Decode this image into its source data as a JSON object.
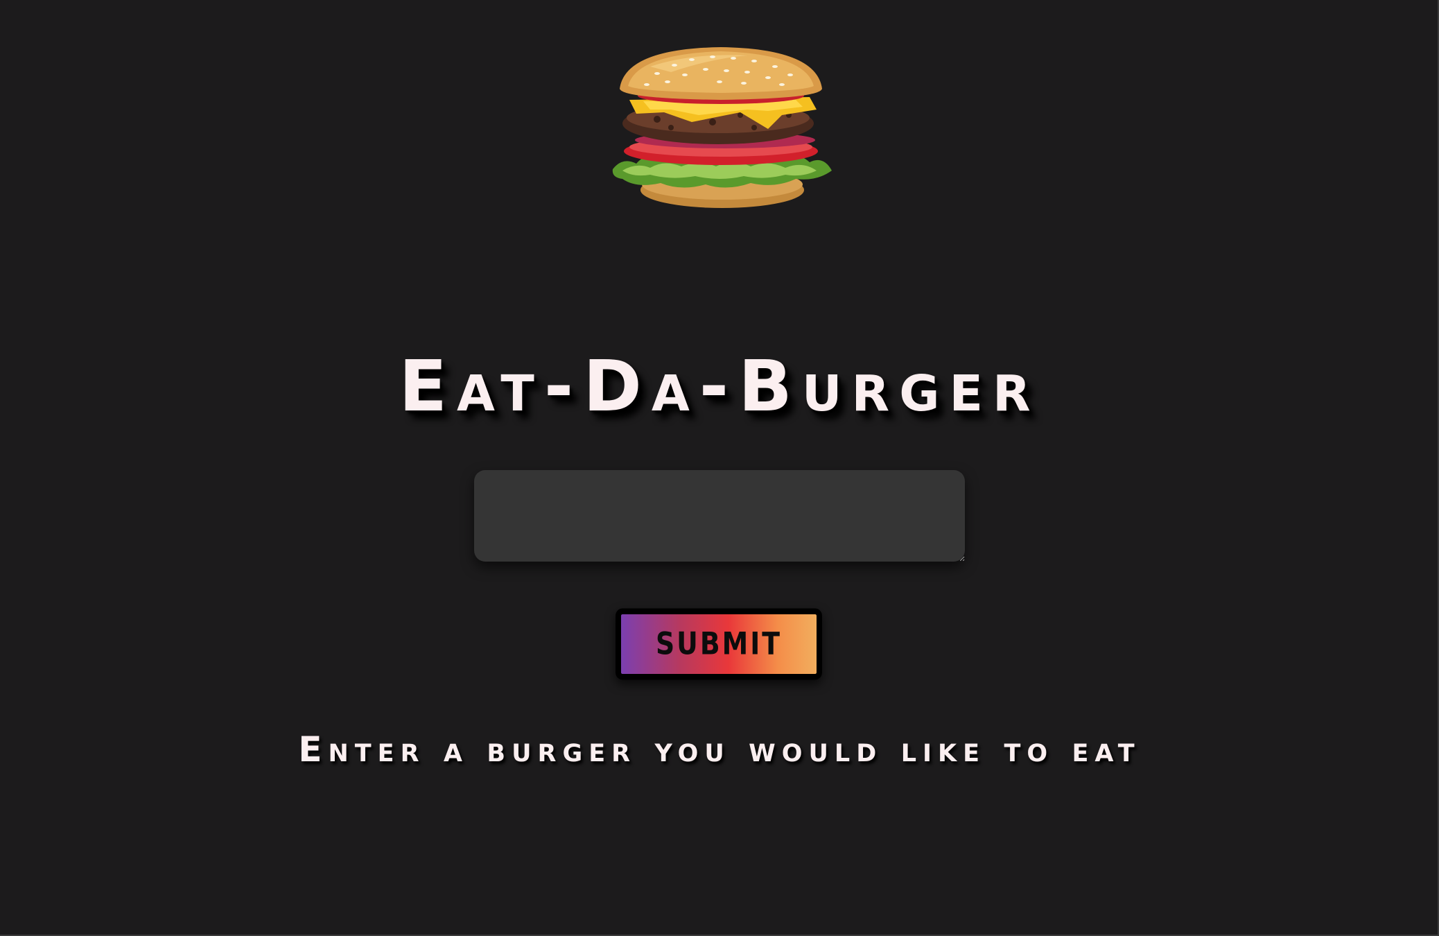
{
  "logo": {
    "icon": "burger-icon"
  },
  "header": {
    "title": "Eat-Da-Burger"
  },
  "form": {
    "burger_input_value": "",
    "submit_label": "SUBMIT",
    "instructions": "Enter a burger you would like to eat"
  },
  "colors": {
    "background": "#1c1b1c",
    "text": "#fbeff0",
    "input_background": "#353535",
    "button_gradient": [
      "#7b3fb0",
      "#e9383a",
      "#f2ae5e"
    ]
  }
}
